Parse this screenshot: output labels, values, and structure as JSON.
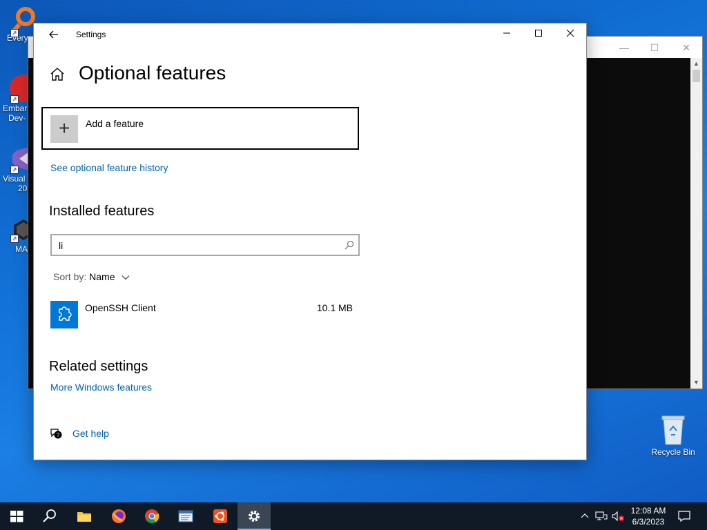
{
  "desktop": {
    "icons": [
      {
        "label": "Every"
      },
      {
        "label": "Embar"
      },
      {
        "label": "Dev-"
      },
      {
        "label": "Visual"
      },
      {
        "label": "20"
      },
      {
        "label": "MA"
      }
    ],
    "recycle_bin": "Recycle Bin"
  },
  "settings": {
    "title": "Settings",
    "page_title": "Optional features",
    "add_feature_label": "Add a feature",
    "history_link": "See optional feature history",
    "installed_title": "Installed features",
    "search": {
      "value": "li"
    },
    "sort": {
      "label": "Sort by:",
      "value": "Name"
    },
    "features": [
      {
        "name": "OpenSSH Client",
        "size": "10.1 MB"
      }
    ],
    "related_title": "Related settings",
    "related_link": "More Windows features",
    "help_link": "Get help"
  },
  "taskbar": {
    "time": "12:08 AM",
    "date": "6/3/2023"
  },
  "colors": {
    "accent": "#0078d7",
    "link": "#0063b1",
    "taskbar": "#101a26"
  }
}
